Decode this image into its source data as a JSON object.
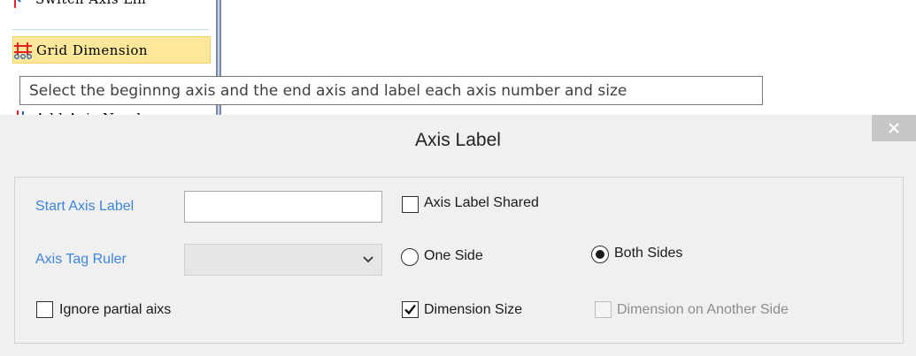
{
  "menu": {
    "items": [
      {
        "label": "Switch Axis Lin"
      },
      {
        "label": "Grid Dimension"
      },
      {
        "label": "Add Axis Number"
      }
    ]
  },
  "tooltip": {
    "text": "Select the beginnng axis and the end axis and label each axis number and size"
  },
  "dialog": {
    "title": "Axis Label",
    "close_glyph": "×",
    "start_axis_label": {
      "label": "Start Axis Label",
      "value": ""
    },
    "axis_tag_ruler": {
      "label": "Axis Tag Ruler",
      "selected": ""
    },
    "ignore_partial": {
      "label": "Ignore partial aixs",
      "checked": false
    },
    "axis_label_shared": {
      "label": "Axis Label Shared",
      "checked": false
    },
    "one_side": {
      "label": "One Side",
      "selected": false
    },
    "both_sides": {
      "label": "Both Sides",
      "selected": true
    },
    "dimension_size": {
      "label": "Dimension Size",
      "checked": true
    },
    "dimension_another_side": {
      "label": "Dimension on Another Side",
      "checked": false,
      "enabled": false
    }
  },
  "colors": {
    "label_blue": "#3d85d8",
    "menu_highlight": "#fce79a",
    "icon_red": "#e02424",
    "icon_blue": "#2b5fb8"
  }
}
